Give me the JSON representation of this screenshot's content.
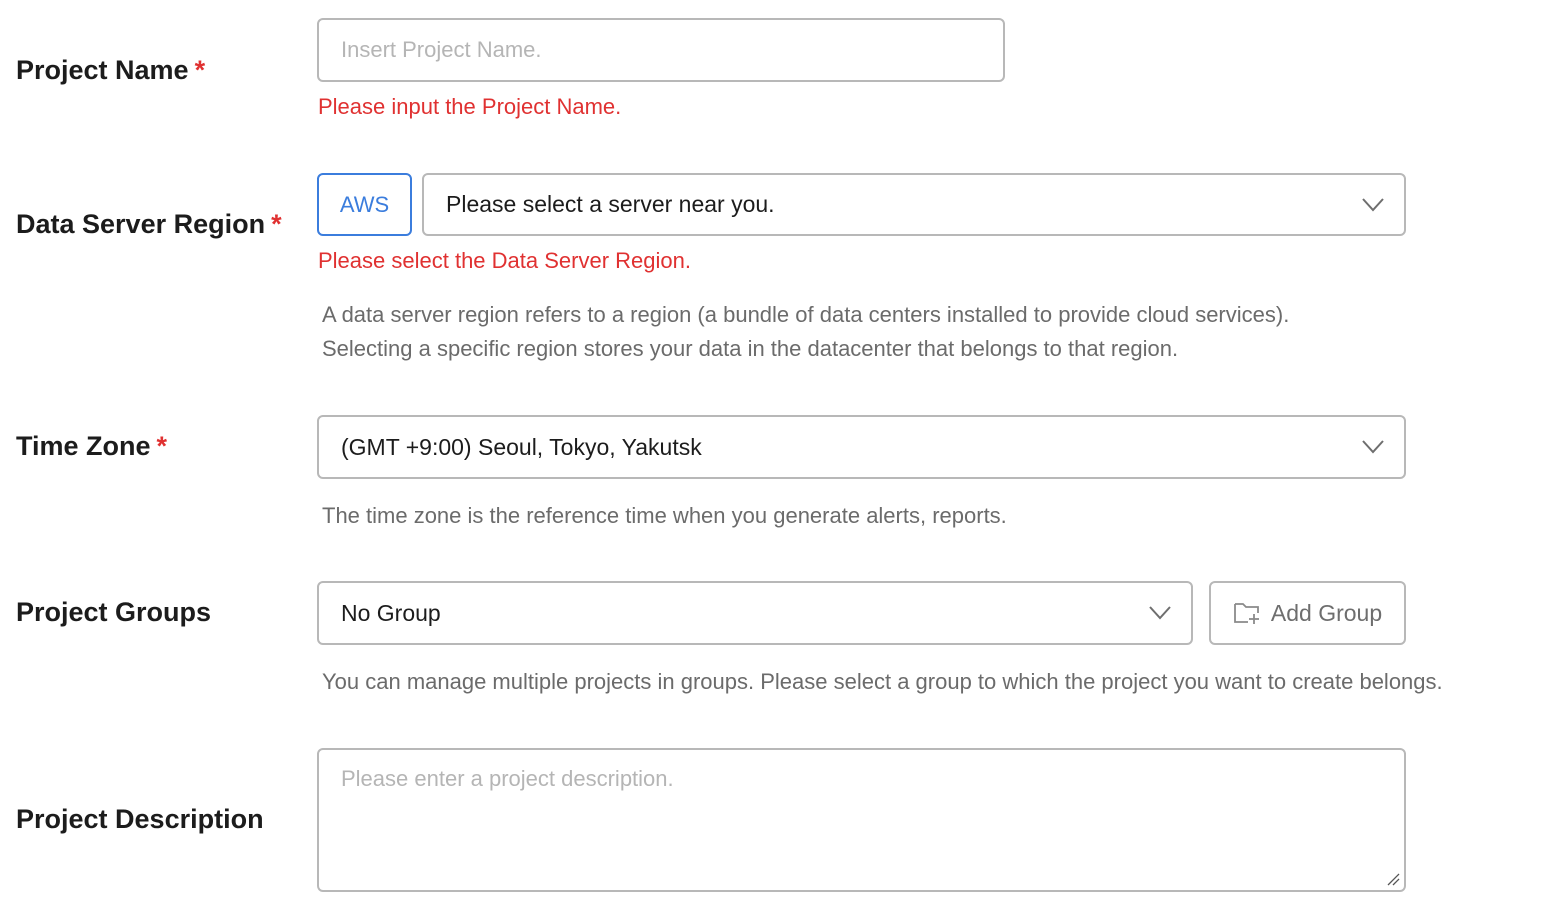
{
  "project_name": {
    "label": "Project Name",
    "required_mark": "*",
    "placeholder": "Insert Project Name.",
    "value": "",
    "error": "Please input the Project Name."
  },
  "data_server_region": {
    "label": "Data Server Region",
    "required_mark": "*",
    "provider_button": "AWS",
    "select_placeholder": "Please select a server near you.",
    "error": "Please select the Data Server Region.",
    "help_line1": "A data server region refers to a region (a bundle of data centers installed to provide cloud services).",
    "help_line2": "Selecting a specific region stores your data in the datacenter that belongs to that region."
  },
  "time_zone": {
    "label": "Time Zone",
    "required_mark": "*",
    "selected": "(GMT +9:00) Seoul, Tokyo, Yakutsk",
    "help": "The time zone is the reference time when you generate alerts, reports."
  },
  "project_groups": {
    "label": "Project Groups",
    "selected": "No Group",
    "add_button": "Add Group",
    "help": "You can manage multiple projects in groups. Please select a group to which the project you want to create belongs."
  },
  "project_description": {
    "label": "Project Description",
    "placeholder": "Please enter a project description.",
    "value": ""
  },
  "icons": {
    "dropdown": "chevron-down-icon",
    "add_group": "folder-add-icon",
    "resize": "resize-grip-icon"
  },
  "colors": {
    "error": "#e03131",
    "accent": "#3b7ddd",
    "border": "#b8b8b8",
    "help_text": "#6b6b6b",
    "placeholder": "#b5b5b5"
  }
}
